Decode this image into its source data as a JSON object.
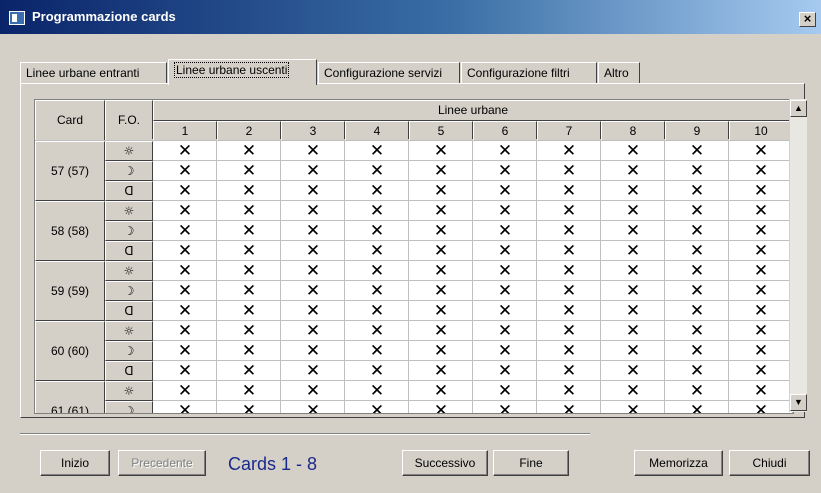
{
  "window": {
    "title": "Programmazione cards",
    "close_label": "×"
  },
  "tabs": [
    {
      "label": "Linee urbane entranti",
      "active": false
    },
    {
      "label": "Linee urbane uscenti",
      "active": true
    },
    {
      "label": "Configurazione servizi",
      "active": false
    },
    {
      "label": "Configurazione filtri",
      "active": false
    },
    {
      "label": "Altro",
      "active": false
    }
  ],
  "grid": {
    "col_card": "Card",
    "col_fo": "F.O.",
    "group_header": "Linee urbane",
    "line_numbers": [
      "1",
      "2",
      "3",
      "4",
      "5",
      "6",
      "7",
      "8",
      "9",
      "10"
    ],
    "cell_mark": "✕",
    "fo_icons": [
      "sun-icon",
      "moon-icon",
      "bell-icon"
    ],
    "fo_symbols": [
      "☼",
      "☽",
      "ᗡ"
    ],
    "cards": [
      "57 (57)",
      "58 (58)",
      "59 (59)",
      "60 (60)",
      "61 (61)"
    ]
  },
  "scrollbar": {
    "up": "▲",
    "down": "▼"
  },
  "footer": {
    "inizio": "Inizio",
    "precedente": "Precedente",
    "cards_range": "Cards  1 - 8",
    "successivo": "Successivo",
    "fine": "Fine",
    "memorizza": "Memorizza",
    "chiudi": "Chiudi"
  }
}
